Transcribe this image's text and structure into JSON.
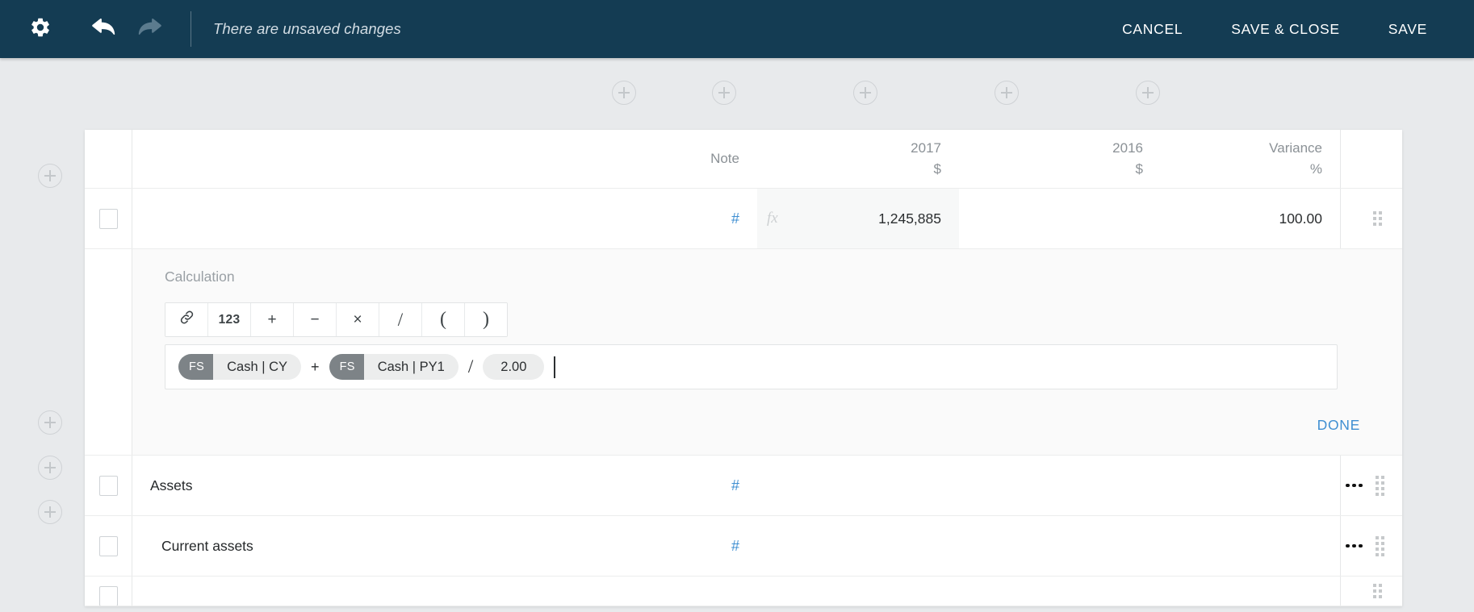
{
  "appbar": {
    "status_text": "There are unsaved changes",
    "icons": {
      "gear": "gear-icon",
      "undo": "undo-arrow-icon",
      "redo": "redo-arrow-icon"
    },
    "actions": [
      {
        "label": "CANCEL",
        "name": "cancel-button"
      },
      {
        "label": "SAVE & CLOSE",
        "name": "save-and-close-button"
      },
      {
        "label": "SAVE",
        "name": "save-button"
      }
    ],
    "background_color": "#143c53"
  },
  "add_buttons": {
    "glyph": "+",
    "column_positions": [
      773,
      897,
      1072,
      1247,
      1422
    ],
    "row_positions": [
      217,
      523,
      579,
      634
    ]
  },
  "table": {
    "header": {
      "note": "Note",
      "year_current": "2017",
      "year_current_unit": "$",
      "year_prior": "2016",
      "year_prior_unit": "$",
      "variance": "Variance",
      "variance_unit": "%"
    },
    "rows": [
      {
        "name": "editing-row",
        "label": "",
        "note": "#",
        "value_current": "1,245,885",
        "value_prior": "",
        "variance": "100.00",
        "fx_icon": "fx",
        "has_kebab": false,
        "indent": 0
      },
      {
        "name": "assets-row",
        "label": "Assets",
        "note": "#",
        "value_current": "",
        "value_prior": "",
        "variance": "",
        "has_kebab": true,
        "indent": 0
      },
      {
        "name": "current-assets-row",
        "label": "Current assets",
        "note": "#",
        "value_current": "",
        "value_prior": "",
        "variance": "",
        "has_kebab": true,
        "indent": 1
      }
    ]
  },
  "calculation": {
    "title": "Calculation",
    "toolbar": [
      {
        "label": "🔗",
        "name": "link-icon-button"
      },
      {
        "label": "123",
        "name": "number-button"
      },
      {
        "label": "+",
        "name": "plus-button"
      },
      {
        "label": "−",
        "name": "minus-button"
      },
      {
        "label": "×",
        "name": "multiply-button"
      },
      {
        "label": "/",
        "name": "divide-button"
      },
      {
        "label": "(",
        "name": "open-paren-button"
      },
      {
        "label": ")",
        "name": "close-paren-button"
      }
    ],
    "formula": [
      {
        "type": "reference",
        "tag": "FS",
        "text": "Cash | CY"
      },
      {
        "type": "operator",
        "text": "+"
      },
      {
        "type": "reference",
        "tag": "FS",
        "text": "Cash | PY1"
      },
      {
        "type": "operator",
        "text": "/"
      },
      {
        "type": "number",
        "text": "2.00"
      }
    ],
    "done_label": "DONE",
    "accent_color": "#3f8fd2"
  }
}
